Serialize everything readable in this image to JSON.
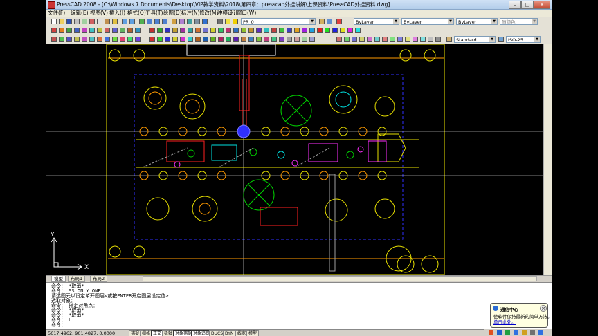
{
  "window": {
    "title": "PressCAD 2008 - [C:\\Windows 7 Documents\\Desktop\\VIP教学资料\\2018\\第四章：presscad外挂讲解\\上课资料\\PressCAD外挂资料.dwg]",
    "controls": {
      "minimize": "–",
      "maximize": "□",
      "close": "✕"
    }
  },
  "menu": [
    "文件(F)",
    "编辑(E)",
    "视图(V)",
    "插入(I)",
    "格式(O)",
    "工具(T)",
    "绘图(D)",
    "标注(N)",
    "修改(M)",
    "冲模设计",
    "窗口(W)"
  ],
  "toolbar": {
    "layer_combo": "PR_0",
    "color_combo": "ByLayer",
    "linetype_combo": "ByLayer",
    "lineweight_combo": "ByLayer",
    "plotstyle_combo": "随颜色",
    "textstyle_combo": "Standard",
    "dimstyle_combo": "ISO-25"
  },
  "colors": {
    "canvas_bg": "#000000",
    "yellow": "#e8e000",
    "orange": "#ff9a00",
    "red": "#ff2020",
    "green": "#00d000",
    "cyan": "#00e0e0",
    "magenta": "#ff30ff",
    "blue": "#4040ff",
    "white": "#ffffff"
  },
  "ucs": {
    "x_label": "X",
    "y_label": "Y"
  },
  "layout_tabs": [
    "模型",
    "布局1",
    "布局2"
  ],
  "command_lines": [
    "命令： *取消*",
    "命令： SS_ONLY_ONE",
    "请选图元以设定单开图层<或按ENTER开启图层设定值>",
    "选取对象：",
    "命令： 指定对角点：",
    "命令： *取消*",
    "命令： *取消*",
    "命令： U",
    "命令："
  ],
  "status": {
    "coords": "5617.4962, 901.4827, 0.0000",
    "buttons": [
      "捕捉",
      "栅格",
      "正交",
      "极轴",
      "对象捕捉",
      "对象追踪",
      "DUCS",
      "DYN",
      "线宽",
      "模型"
    ]
  },
  "balloon": {
    "title": "通信中心",
    "body": "使软件保持最新的简单方法。",
    "link": "单击此处。"
  }
}
